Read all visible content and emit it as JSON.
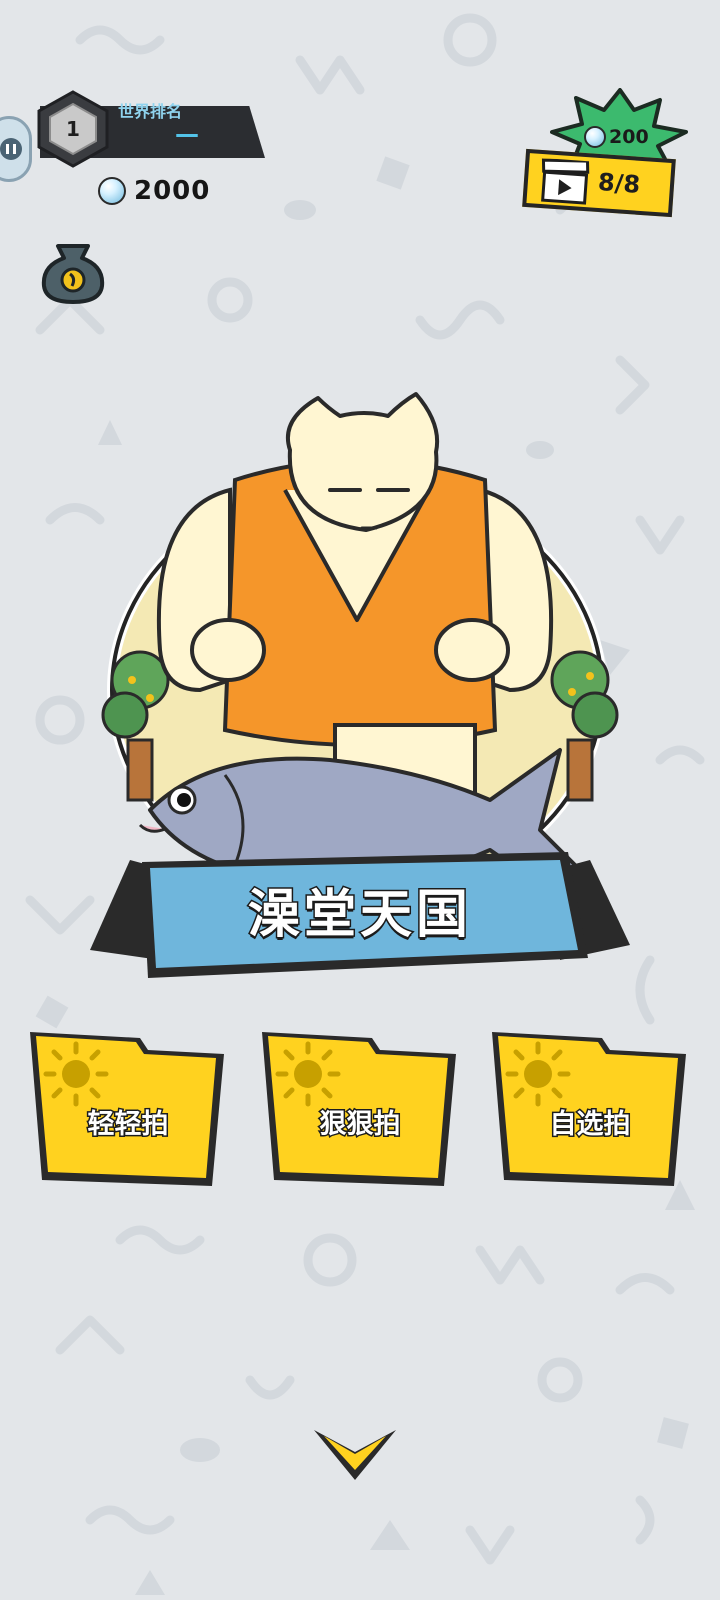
{
  "status": {
    "rank_label": "世界排名",
    "rank_value": "—",
    "rank_badge_number": "1",
    "pearls": "2000"
  },
  "reward": {
    "pearls": "200",
    "video_count": "8/8"
  },
  "stage": {
    "title": "澡堂天国"
  },
  "modes": [
    {
      "label": "轻轻拍",
      "icon": "sun-icon"
    },
    {
      "label": "狠狠拍",
      "icon": "sun-icon"
    },
    {
      "label": "自选拍",
      "icon": "sun-icon"
    }
  ],
  "colors": {
    "background": "#e3e6e9",
    "folder_yellow": "#ffd21f",
    "banner_blue": "#6fb6dc",
    "tank_orange": "#f5962a",
    "reward_green": "#3cba6e"
  },
  "icons": {
    "pause": "pause-icon",
    "pouch": "money-pouch-icon",
    "video": "video-clapper-icon",
    "scroll": "chevron-down-icon"
  }
}
